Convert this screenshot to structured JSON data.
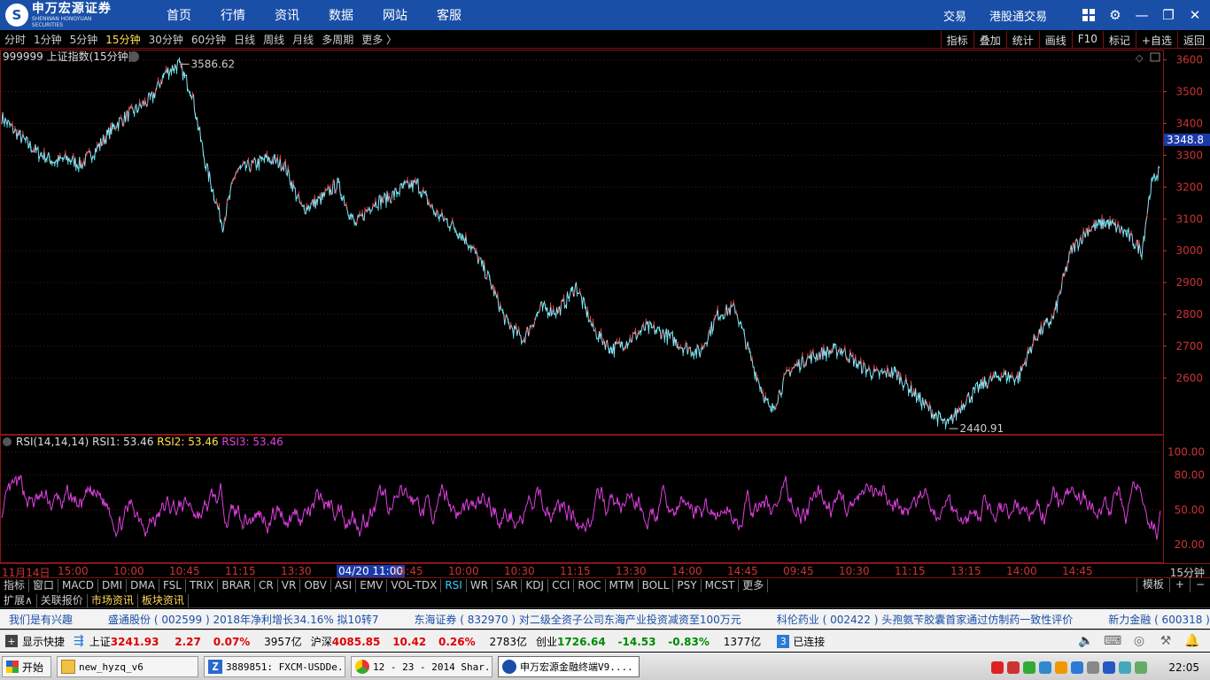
{
  "header": {
    "logo_cn": "申万宏源证券",
    "logo_en": "SHENWAN HONGYUAN SECURITIES",
    "nav": [
      "首页",
      "行情",
      "资讯",
      "数据",
      "网站",
      "客服"
    ],
    "right_links": [
      "交易",
      "港股通交易"
    ]
  },
  "periods": [
    "分时",
    "1分钟",
    "5分钟",
    "15分钟",
    "30分钟",
    "60分钟",
    "日线",
    "周线",
    "月线",
    "多周期",
    "更多 〉"
  ],
  "active_period": "15分钟",
  "right_tools": [
    "指标",
    "叠加",
    "统计",
    "画线",
    "F10",
    "标记",
    "+自选",
    "返回"
  ],
  "chart_title": "999999 上证指数(15分钟)",
  "rsi_title": {
    "name": "RSI(14,14,14)",
    "rsi1": "RSI1: 53.46",
    "rsi2": "RSI2: 53.46",
    "rsi3": "RSI3: 53.46"
  },
  "time_axis": {
    "labels": [
      "11月14日",
      "15:00",
      "10:00",
      "10:45",
      "11:15",
      "13:30",
      "04/20 11:00",
      "14:45",
      "10:00",
      "10:30",
      "11:15",
      "13:30",
      "14:00",
      "14:45",
      "09:45",
      "10:30",
      "11:15",
      "13:15",
      "14:00",
      "14:45"
    ],
    "period_label": "15分钟",
    "cursor_label": "04/20 11:00"
  },
  "chart_data": [
    {
      "type": "line",
      "title": "999999 上证指数(15分钟)",
      "y_ticks": [
        2600,
        2700,
        2800,
        2900,
        3000,
        3100,
        3200,
        3300,
        3400,
        3500,
        3600
      ],
      "ylim": [
        2430,
        3610
      ],
      "current_value": "3348.8",
      "annotations": [
        {
          "label": "3586.62",
          "value": 3586.62
        },
        {
          "label": "2440.91",
          "value": 2440.91
        }
      ],
      "x_index": [
        0,
        20,
        40,
        60,
        75,
        90,
        110,
        130,
        150,
        170,
        185,
        200,
        215,
        230,
        250,
        265,
        285,
        300,
        320,
        340,
        360,
        380,
        400,
        420,
        440,
        455,
        470,
        490,
        510,
        530,
        550,
        570,
        590,
        610,
        630,
        650,
        670,
        690,
        710,
        730,
        750,
        770,
        790,
        810,
        830,
        850,
        870,
        890,
        910,
        930,
        950,
        970,
        990,
        1010,
        1030,
        1050,
        1070,
        1090,
        1110,
        1130,
        1150,
        1170,
        1190,
        1210,
        1230,
        1250,
        1270,
        1290,
        1300,
        1310
      ],
      "values": [
        3420,
        3360,
        3310,
        3280,
        3290,
        3270,
        3330,
        3400,
        3440,
        3480,
        3560,
        3586,
        3500,
        3280,
        3080,
        3250,
        3270,
        3290,
        3270,
        3130,
        3160,
        3210,
        3080,
        3150,
        3170,
        3200,
        3210,
        3120,
        3080,
        3020,
        2920,
        2780,
        2720,
        2820,
        2810,
        2890,
        2750,
        2690,
        2720,
        2760,
        2740,
        2700,
        2680,
        2800,
        2820,
        2640,
        2490,
        2620,
        2660,
        2680,
        2690,
        2640,
        2610,
        2620,
        2560,
        2500,
        2450,
        2530,
        2580,
        2610,
        2600,
        2730,
        2790,
        3000,
        3070,
        3090,
        3060,
        3000,
        3200,
        3260
      ]
    },
    {
      "type": "line",
      "title": "RSI(14,14,14)",
      "y_ticks": [
        20.0,
        50.0,
        80.0,
        100.0
      ],
      "ylim": [
        10,
        105
      ],
      "series": [
        {
          "name": "RSI3",
          "color": "#e040e0"
        }
      ]
    }
  ],
  "indicator_tabs": [
    "指标",
    "窗口",
    "MACD",
    "DMI",
    "DMA",
    "FSL",
    "TRIX",
    "BRAR",
    "CR",
    "VR",
    "OBV",
    "ASI",
    "EMV",
    "VOL-TDX",
    "RSI",
    "WR",
    "SAR",
    "KDJ",
    "CCI",
    "ROC",
    "MTM",
    "BOLL",
    "PSY",
    "MCST",
    "更多"
  ],
  "active_indicator": "RSI",
  "indicator_right": [
    "模板",
    "+",
    "−"
  ],
  "sub_tabs": [
    "扩展∧",
    "关联报价",
    "市场资讯",
    "板块资讯"
  ],
  "ticker": [
    "我们是有兴趣",
    "盛通股份 ( 002599 ) 2018年净利增长34.16% 拟10转7",
    "东海证券 ( 832970 ) 对二级全资子公司东海产业投资减资至100万元",
    "科伦药业 ( 002422 ) 头孢氨苄胶囊首家通过仿制药一致性评价",
    "新力金融 ( 600318 ) 确定回购股"
  ],
  "status": {
    "show_btn": "显示快捷",
    "sh": {
      "name": "上证",
      "price": "3241.93",
      "chg": "2.27",
      "pct": "0.07%",
      "amt": "3957亿"
    },
    "hs": {
      "name": "沪深",
      "price": "4085.85",
      "chg": "10.42",
      "pct": "0.26%",
      "amt": "2783亿"
    },
    "cy": {
      "name": "创业",
      "price": "1726.64",
      "chg": "-14.53",
      "pct": "-0.83%",
      "amt": "1377亿"
    },
    "conn_num": "3",
    "conn_text": "已连接"
  },
  "taskbar": {
    "start": "开始",
    "tasks": [
      "new_hyzq_v6",
      "3889851: FXCM-USDDe...",
      "12 - 23 - 2014 Shar...",
      "申万宏源金融终端V9...."
    ],
    "clock": "22:05"
  }
}
